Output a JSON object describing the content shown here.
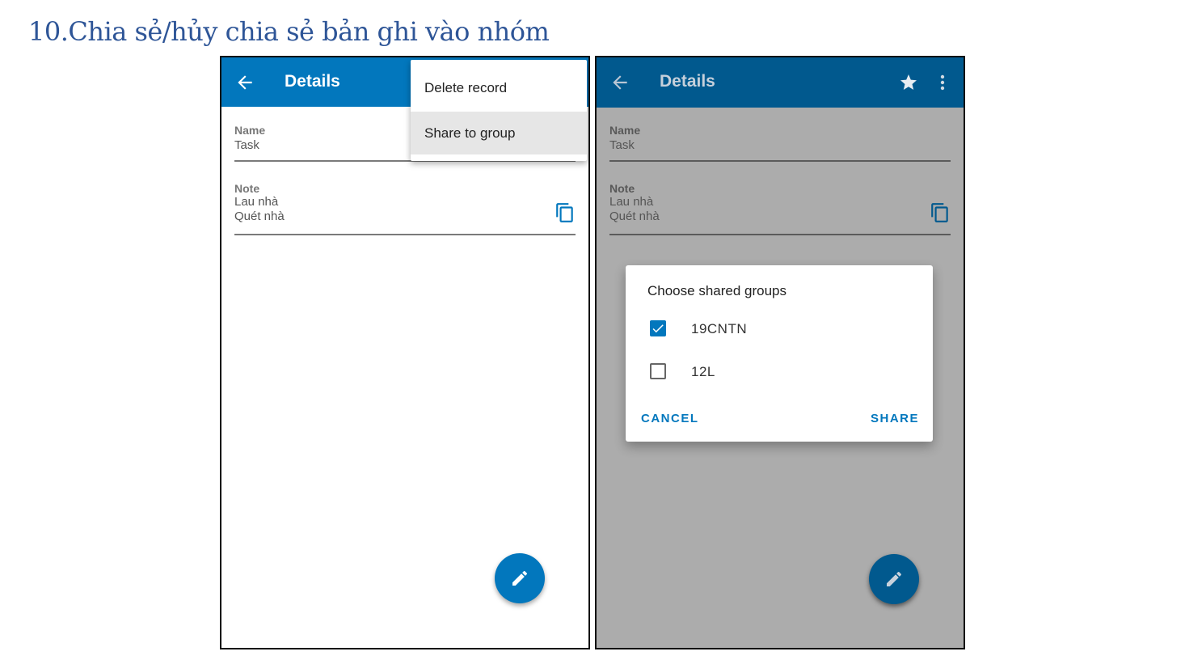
{
  "doc": {
    "heading": "10.Chia sẻ/hủy chia sẻ bản ghi vào nhóm"
  },
  "screen1": {
    "title": "Details",
    "name_label": "Name",
    "name_value": "Task",
    "note_label": "Note",
    "note_lines": [
      "Lau nhà",
      "Quét nhà"
    ],
    "menu": {
      "items": [
        {
          "label": "Delete record"
        },
        {
          "label": "Share to group",
          "highlighted": true
        }
      ]
    }
  },
  "screen2": {
    "title": "Details",
    "name_label": "Name",
    "name_value": "Task",
    "note_label": "Note",
    "note_lines": [
      "Lau nhà",
      "Quét nhà"
    ],
    "dialog": {
      "title": "Choose shared groups",
      "options": [
        {
          "label": "19CNTN",
          "checked": true
        },
        {
          "label": "12L",
          "checked": false
        }
      ],
      "cancel_label": "CANCEL",
      "share_label": "SHARE"
    }
  },
  "colors": {
    "appbar": "#0277bd",
    "appbar_dimmed": "#01598e",
    "scrim": "#acacac",
    "accent": "#0277bd",
    "heading": "#2e5597"
  },
  "icons": [
    "back-arrow-icon",
    "star-icon",
    "more-vert-icon",
    "copy-icon",
    "pencil-icon",
    "check-icon"
  ]
}
